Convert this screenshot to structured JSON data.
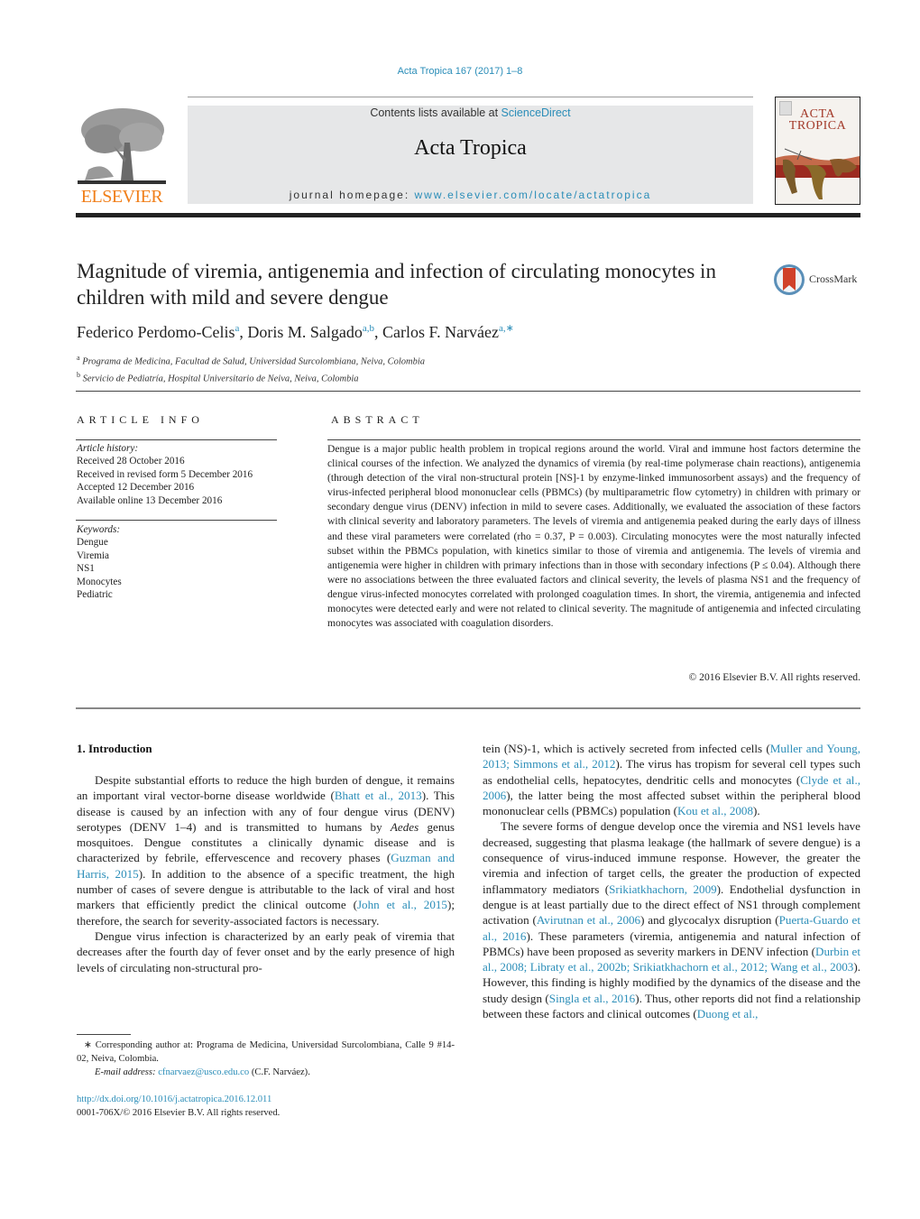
{
  "header": {
    "journal_ref": "Acta Tropica 167 (2017) 1–8",
    "publisher_logo_text": "ELSEVIER",
    "contents_prefix": "Contents lists available at ",
    "contents_link": "ScienceDirect",
    "journal_title": "Acta Tropica",
    "homepage_prefix": "journal homepage: ",
    "homepage_link": "www.elsevier.com/locate/actatropica",
    "cover_title_line1": "ACTA",
    "cover_title_line2": "TROPICA",
    "brand_color": "#f07f1a",
    "link_color": "#2a8db8"
  },
  "article": {
    "title": "Magnitude of viremia, antigenemia and infection of circulating monocytes in children with mild and severe dengue",
    "crossmark_label": "CrossMark",
    "authors": [
      {
        "name": "Federico Perdomo-Celis",
        "sup": "a"
      },
      {
        "name": "Doris M. Salgado",
        "sup": "a,b"
      },
      {
        "name": "Carlos F. Narváez",
        "sup": "a,∗"
      }
    ],
    "affiliations": [
      {
        "sup": "a",
        "text": "Programa de Medicina, Facultad de Salud, Universidad Surcolombiana, Neiva, Colombia"
      },
      {
        "sup": "b",
        "text": "Servicio de Pediatría, Hospital Universitario de Neiva, Neiva, Colombia"
      }
    ]
  },
  "article_info": {
    "heading": "ARTICLE INFO",
    "history_label": "Article history:",
    "history": [
      "Received 28 October 2016",
      "Received in revised form 5 December 2016",
      "Accepted 12 December 2016",
      "Available online 13 December 2016"
    ],
    "keywords_label": "Keywords:",
    "keywords": [
      "Dengue",
      "Viremia",
      "NS1",
      "Monocytes",
      "Pediatric"
    ]
  },
  "abstract": {
    "heading": "ABSTRACT",
    "text": "Dengue is a major public health problem in tropical regions around the world. Viral and immune host factors determine the clinical courses of the infection. We analyzed the dynamics of viremia (by real-time polymerase chain reactions), antigenemia (through detection of the viral non-structural protein [NS]-1 by enzyme-linked immunosorbent assays) and the frequency of virus-infected peripheral blood mononuclear cells (PBMCs) (by multiparametric flow cytometry) in children with primary or secondary dengue virus (DENV) infection in mild to severe cases. Additionally, we evaluated the association of these factors with clinical severity and laboratory parameters. The levels of viremia and antigenemia peaked during the early days of illness and these viral parameters were correlated (rho = 0.37, P = 0.003). Circulating monocytes were the most naturally infected subset within the PBMCs population, with kinetics similar to those of viremia and antigenemia. The levels of viremia and antigenemia were higher in children with primary infections than in those with secondary infections (P ≤ 0.04). Although there were no associations between the three evaluated factors and clinical severity, the levels of plasma NS1 and the frequency of dengue virus-infected monocytes correlated with prolonged coagulation times. In short, the viremia, antigenemia and infected monocytes were detected early and were not related to clinical severity. The magnitude of antigenemia and infected circulating monocytes was associated with coagulation disorders.",
    "copyright": "© 2016 Elsevier B.V. All rights reserved."
  },
  "body": {
    "section_heading": "1.  Introduction",
    "left": {
      "p1": [
        {
          "t": "Despite substantial efforts to reduce the high burden of dengue, it remains an important viral vector-borne disease worldwide ("
        },
        {
          "t": "Bhatt et al., 2013",
          "link": true
        },
        {
          "t": "). This disease is caused by an infection with any of four dengue virus (DENV) serotypes (DENV 1–4) and is transmitted to humans by "
        },
        {
          "t": "Aedes",
          "italic": true
        },
        {
          "t": " genus mosquitoes. Dengue constitutes a clinically dynamic disease and is characterized by febrile, effervescence and recovery phases ("
        },
        {
          "t": "Guzman and Harris, 2015",
          "link": true
        },
        {
          "t": "). In addition to the absence of a specific treatment, the high number of cases of severe dengue is attributable to the lack of viral and host markers that efficiently predict the clinical outcome ("
        },
        {
          "t": "John et al., 2015",
          "link": true
        },
        {
          "t": "); therefore, the search for severity-associated factors is necessary."
        }
      ],
      "p2": [
        {
          "t": "Dengue virus infection is characterized by an early peak of viremia that decreases after the fourth day of fever onset and by the early presence of high levels of circulating non-structural pro-"
        }
      ]
    },
    "right": {
      "p1": [
        {
          "t": "tein (NS)-1, which is actively secreted from infected cells ("
        },
        {
          "t": "Muller and Young, 2013; Simmons et al., 2012",
          "link": true
        },
        {
          "t": "). The virus has tropism for several cell types such as endothelial cells, hepatocytes, dendritic cells and monocytes ("
        },
        {
          "t": "Clyde et al., 2006",
          "link": true
        },
        {
          "t": "), the latter being the most affected subset within the peripheral blood mononuclear cells (PBMCs) population ("
        },
        {
          "t": "Kou et al., 2008",
          "link": true
        },
        {
          "t": ")."
        }
      ],
      "p2": [
        {
          "t": "The severe forms of dengue develop once the viremia and NS1 levels have decreased, suggesting that plasma leakage (the hallmark of severe dengue) is a consequence of virus-induced immune response. However, the greater the viremia and infection of target cells, the greater the production of expected inflammatory mediators ("
        },
        {
          "t": "Srikiatkhachorn, 2009",
          "link": true
        },
        {
          "t": "). Endothelial dysfunction in dengue is at least partially due to the direct effect of NS1 through complement activation ("
        },
        {
          "t": "Avirutnan et al., 2006",
          "link": true
        },
        {
          "t": ") and glycocalyx disruption ("
        },
        {
          "t": "Puerta-Guardo et al., 2016",
          "link": true
        },
        {
          "t": "). These parameters (viremia, antigenemia and natural infection of PBMCs) have been proposed as severity markers in DENV infection ("
        },
        {
          "t": "Durbin et al., 2008; Libraty et al., 2002b; Srikiatkhachorn et al., 2012; Wang et al., 2003",
          "link": true
        },
        {
          "t": "). However, this finding is highly modified by the dynamics of the disease and the study design ("
        },
        {
          "t": "Singla et al., 2016",
          "link": true
        },
        {
          "t": "). Thus, other reports did not find a relationship between these factors and clinical outcomes ("
        },
        {
          "t": "Duong et al.,",
          "link": true
        }
      ]
    }
  },
  "footnote": {
    "corresponding": "∗  Corresponding author at: Programa de Medicina, Universidad Surcolombiana, Calle 9 #14-02, Neiva, Colombia.",
    "email_label": "E-mail address: ",
    "email": "cfnarvaez@usco.edu.co",
    "email_suffix": " (C.F. Narváez).",
    "doi": "http://dx.doi.org/10.1016/j.actatropica.2016.12.011",
    "issn": "0001-706X/© 2016 Elsevier B.V. All rights reserved."
  }
}
